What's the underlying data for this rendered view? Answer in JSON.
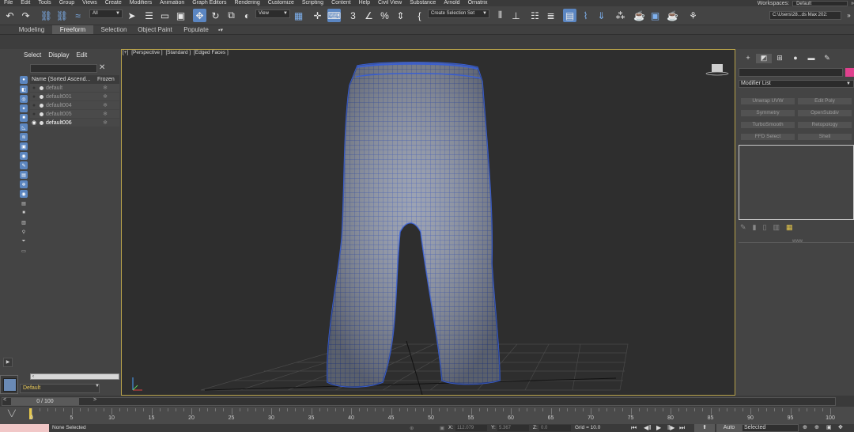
{
  "menu": [
    "File",
    "Edit",
    "Tools",
    "Group",
    "Views",
    "Create",
    "Modifiers",
    "Animation",
    "Graph Editors",
    "Rendering",
    "Customize",
    "Scripting",
    "Content",
    "Help",
    "Civil View",
    "Substance",
    "Arnold",
    "Ornatrix"
  ],
  "workspace": {
    "label": "Workspaces:",
    "value": "Default"
  },
  "toolbar": {
    "filter_value": "All",
    "refcoord_value": "View",
    "selection_set_placeholder": "Create Selection Set",
    "path_value": "C:\\Users\\28...ds Max 202:"
  },
  "ribbon": {
    "tabs": [
      "Modeling",
      "Freeform",
      "Selection",
      "Object Paint",
      "Populate"
    ],
    "selected": "Freeform"
  },
  "scene_explorer": {
    "menu": [
      "Select",
      "Display",
      "Edit"
    ],
    "header_name": "Name (Sorted Ascend...",
    "header_frozen": "Frozen",
    "rows": [
      {
        "name": "default",
        "selected": false
      },
      {
        "name": "default001",
        "selected": false
      },
      {
        "name": "default004",
        "selected": false
      },
      {
        "name": "default005",
        "selected": false
      },
      {
        "name": "default006",
        "selected": true
      }
    ],
    "layer": "Default"
  },
  "viewport": {
    "labels": [
      "[+]",
      "[Perspective ]",
      "[Standard ]",
      "[Edged Faces ]"
    ]
  },
  "command_panel": {
    "modifier_list": "Modifier List",
    "buttons": [
      "Unwrap UVW",
      "Edit Poly",
      "Symmetry",
      "OpenSubdiv",
      "TurboSmooth",
      "Retopology",
      "FFD Select",
      "Shell"
    ],
    "color": "#e0418e",
    "separator": "www"
  },
  "timeline": {
    "frame_readout": "0 / 100",
    "ticks": [
      0,
      5,
      10,
      15,
      20,
      25,
      30,
      35,
      40,
      45,
      50,
      55,
      60,
      65,
      70,
      75,
      80,
      85,
      90,
      95,
      100
    ]
  },
  "status": {
    "selection": "None Selected",
    "x_label": "X:",
    "x_value": "112.079",
    "y_label": "Y:",
    "y_value": "5.367",
    "z_label": "Z:",
    "z_value": "0.0",
    "grid": "Grid = 10.0",
    "auto_key": "Auto",
    "selected_dd": "Selected"
  }
}
